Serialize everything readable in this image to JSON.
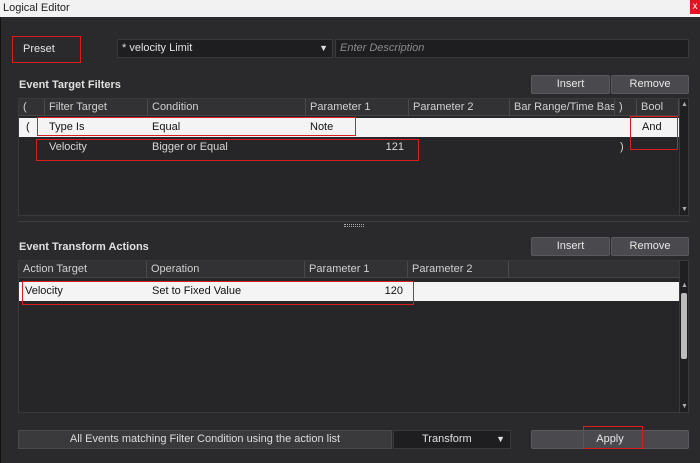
{
  "window": {
    "title": "Logical Editor",
    "close_glyph": "x"
  },
  "preset": {
    "label": "Preset",
    "selected": "* velocity Limit",
    "description_placeholder": "Enter Description"
  },
  "filters": {
    "title": "Event Target Filters",
    "insert_label": "Insert",
    "remove_label": "Remove",
    "columns": [
      "(",
      "Filter Target",
      "Condition",
      "Parameter 1",
      "Parameter 2",
      "Bar Range/Time Base",
      ")",
      "Bool"
    ],
    "rows": [
      {
        "open": "(",
        "target": "Type Is",
        "condition": "Equal",
        "param1": "Note",
        "param2": "",
        "range": "",
        "close": "",
        "bool": "And"
      },
      {
        "open": "",
        "target": "Velocity",
        "condition": "Bigger or Equal",
        "param1": "121",
        "param2": "",
        "range": "",
        "close": ")",
        "bool": ""
      }
    ]
  },
  "actions": {
    "title": "Event Transform Actions",
    "insert_label": "Insert",
    "remove_label": "Remove",
    "columns": [
      "Action Target",
      "Operation",
      "Parameter 1",
      "Parameter 2"
    ],
    "rows": [
      {
        "target": "Velocity",
        "operation": "Set to Fixed Value",
        "param1": "120",
        "param2": ""
      }
    ]
  },
  "footer": {
    "mode_text": "All Events matching Filter Condition using the action list",
    "function": "Transform",
    "apply_label": "Apply"
  },
  "colors": {
    "highlight": "#d81e1e",
    "selected_row": "#f4f4f4"
  }
}
